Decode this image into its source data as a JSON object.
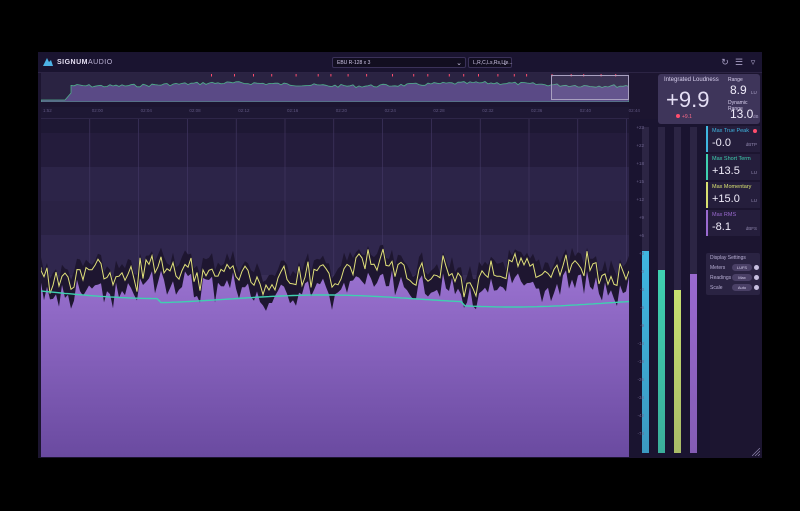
{
  "app": {
    "brand_bold": "SIGNUM",
    "brand_light": "AUDIO"
  },
  "toolbar": {
    "preset_dropdown": "EBU R-128 x 3",
    "channels_dropdown": "L,R,C,Ls,Rs,Lfe..."
  },
  "timeline": {
    "labels": [
      "1:52",
      "02:00",
      "02:04",
      "02:08",
      "02:12",
      "02:16",
      "02:20",
      "02:24",
      "02:28",
      "02:32",
      "02:36",
      "02:40",
      "02:44"
    ]
  },
  "meter_scale": [
    "+23",
    "+22",
    "+18",
    "+15",
    "+12",
    "+9",
    "+6",
    "+3",
    "0",
    "-3",
    "-6",
    "-9",
    "-14",
    "-18",
    "-26",
    "-34",
    "-42",
    "-74"
  ],
  "integrated": {
    "title": "Integrated Loudness",
    "value": "+9.9",
    "sub": "+9.1"
  },
  "range": {
    "range_label": "Range",
    "range_value": "8.9",
    "range_unit": "LU",
    "dr_label": "Dynamic Range",
    "dr_value": "13.0",
    "dr_unit": "dB"
  },
  "stats": [
    {
      "title": "Max True Peak",
      "value": "-0.0",
      "unit": "dBTP",
      "color": "#3fb6e0",
      "dot": true
    },
    {
      "title": "Max Short Term",
      "value": "+13.5",
      "unit": "LU",
      "color": "#3fd0b0",
      "dot": false
    },
    {
      "title": "Max Momentary",
      "value": "+15.0",
      "unit": "LU",
      "color": "#d8e070",
      "dot": false
    },
    {
      "title": "Max RMS",
      "value": "-8.1",
      "unit": "dBFS",
      "color": "#9a6ad0",
      "dot": false
    }
  ],
  "display_settings": {
    "title": "Display Settings",
    "meters_label": "Meters",
    "meters_value": "LUFS",
    "readings_label": "Readings",
    "readings_value": "Max",
    "scale_label": "Scale",
    "scale_value": "Auto"
  },
  "meter_levels": [
    0.62,
    0.56,
    0.5,
    0.55
  ],
  "colors": {
    "accent_teal": "#3fd0b0",
    "accent_yellow": "#d8e070",
    "accent_purple": "#8a5cc4",
    "alert_red": "#ff4d6d"
  }
}
